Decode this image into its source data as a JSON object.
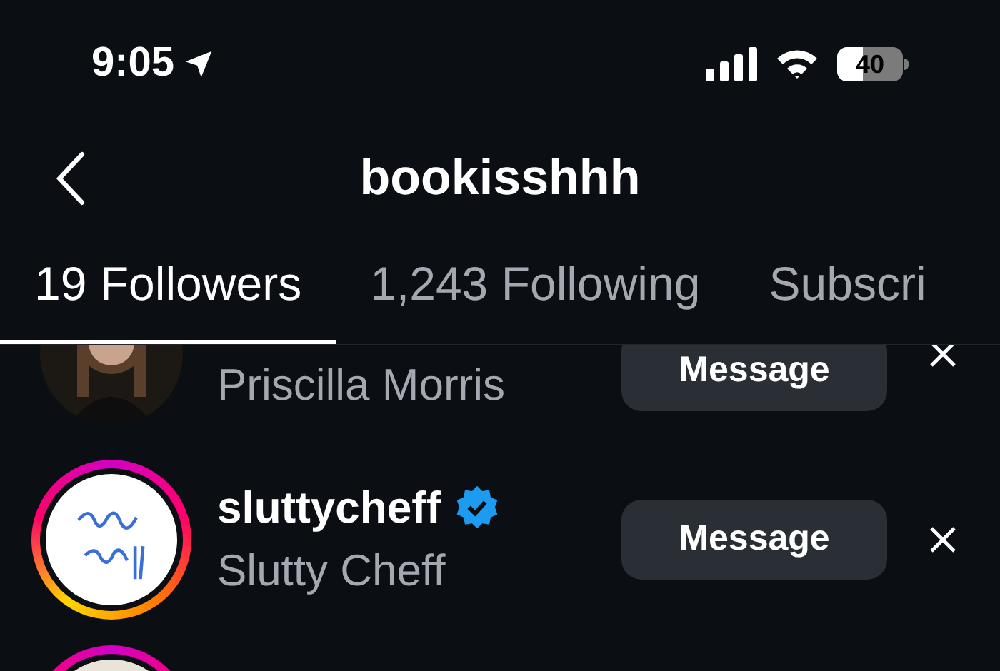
{
  "status_bar": {
    "time": "9:05",
    "battery": {
      "text": "40",
      "level": 0.4
    }
  },
  "header": {
    "title": "bookisshhh"
  },
  "tabs": [
    {
      "label": "19 Followers",
      "selected": true
    },
    {
      "label": "1,243 Following",
      "selected": false
    },
    {
      "label": "Subscri",
      "selected": false
    }
  ],
  "rows": [
    {
      "display_name": "Priscilla Morris",
      "button": "Message",
      "story": false
    },
    {
      "username": "sluttycheff",
      "display_name": "Slutty Cheff",
      "button": "Message",
      "story": true,
      "verified": true
    },
    {
      "story": true
    }
  ]
}
